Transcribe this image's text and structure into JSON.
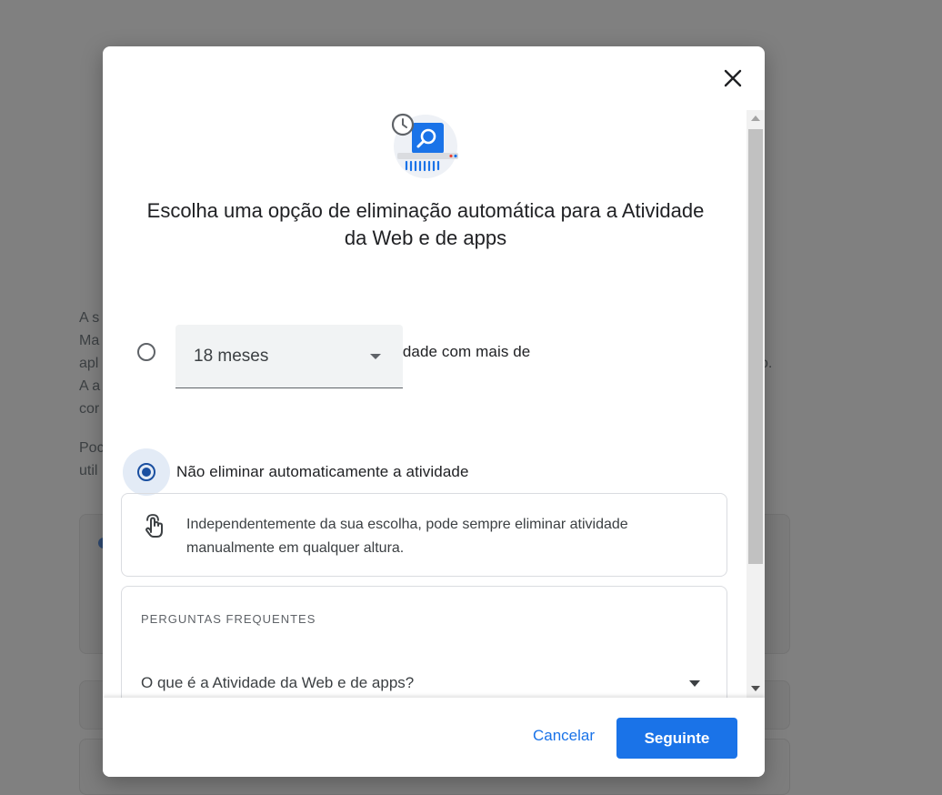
{
  "background": {
    "fragments": [
      "A s",
      "Ma",
      "apl",
      "A a",
      "cor",
      "Poc",
      "util",
      "o."
    ]
  },
  "dialog": {
    "close_icon": "close-icon",
    "illustration_icon": "auto-delete-history-illustration",
    "title": "Escolha uma opção de eliminação automática para a Atividade da Web e de apps",
    "options": [
      {
        "label": "Eliminar automaticamente a atividade com mais de",
        "selected": false
      },
      {
        "label": "Não eliminar automaticamente a atividade",
        "selected": true
      }
    ],
    "period_select": {
      "value": "18 meses"
    },
    "info": {
      "icon": "hand-gesture-icon",
      "text": "Independentemente da sua escolha, pode sempre eliminar atividade manualmente em qualquer altura."
    },
    "faq": {
      "heading": "PERGUNTAS FREQUENTES",
      "items": [
        {
          "question": "O que é a Atividade da Web e de apps?"
        }
      ]
    },
    "footer": {
      "cancel_label": "Cancelar",
      "next_label": "Seguinte"
    }
  },
  "colors": {
    "accent": "#1a73e8",
    "radio_selected": "#1a4fa0",
    "overlay": "#808080"
  }
}
